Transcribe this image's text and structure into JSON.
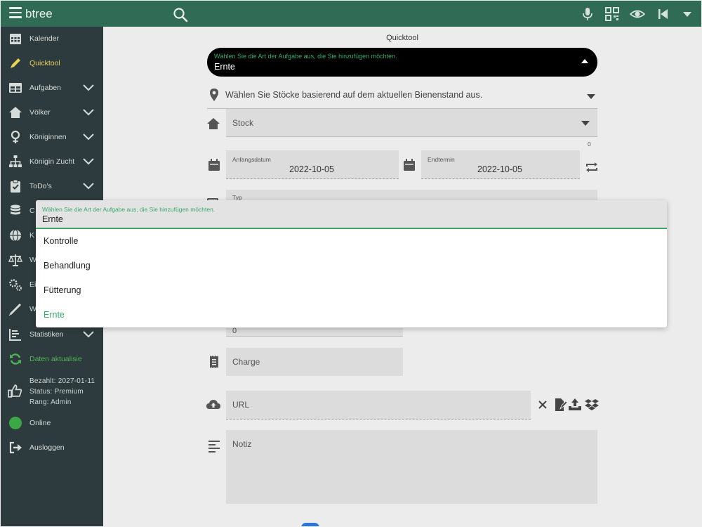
{
  "app": {
    "title": "btree"
  },
  "topbar": {
    "icons": [
      "menu-icon",
      "search-icon",
      "microphone-icon",
      "qr-code-icon",
      "eye-icon",
      "skip-back-icon",
      "caret-down-icon"
    ]
  },
  "sidebar": {
    "items": [
      {
        "label": "Kalender",
        "icon": "calendar-icon"
      },
      {
        "label": "Quicktool",
        "icon": "pencil-icon",
        "active": true
      },
      {
        "label": "Aufgaben",
        "icon": "table-icon",
        "expandable": true
      },
      {
        "label": "Völker",
        "icon": "home-icon",
        "expandable": true
      },
      {
        "label": "Königinnen",
        "icon": "female-icon",
        "expandable": true
      },
      {
        "label": "Königin Zucht",
        "icon": "sitemap-icon",
        "expandable": true
      },
      {
        "label": "ToDo's",
        "icon": "clipboard-check-icon",
        "expandable": true
      },
      {
        "label": "C",
        "icon": "database-icon"
      },
      {
        "label": "K",
        "icon": "globe-icon"
      },
      {
        "label": "W",
        "icon": "scale-icon"
      },
      {
        "label": "Ei",
        "icon": "cogs-icon"
      },
      {
        "label": "W",
        "icon": "syringe-icon"
      },
      {
        "label": "Statistiken",
        "icon": "chart-icon",
        "expandable": true
      },
      {
        "label": "Daten aktualisieren",
        "icon": "sync-icon"
      }
    ],
    "account": {
      "paid": "Bezahlt: 2027-01-11",
      "status": "Status: Premium",
      "rank": "Rang: Admin"
    },
    "online_label": "Online",
    "logout_label": "Ausloggen"
  },
  "main": {
    "title": "Quicktool",
    "task_type": {
      "label": "Wählen Sie die Art der Aufgabe aus, die Sie hinzufügen möchten.",
      "value": "Ernte"
    },
    "location_hint": "Wählen Sie Stöcke basierend auf dem aktuellen Bienenstand aus.",
    "hive_select": "Stock",
    "hive_count": "0",
    "start_date": {
      "label": "Anfangsdatum",
      "value": "2022-10-05"
    },
    "end_date": {
      "label": "Endtermin",
      "value": "2022-10-05"
    },
    "type_field": {
      "label": "Typ"
    },
    "amount_value": "0",
    "batch_placeholder": "Charge",
    "url_placeholder": "URL",
    "note_placeholder": "Notiz"
  },
  "dropdown": {
    "label": "Wählen Sie die Art der Aufgabe aus, die Sie hinzufügen möchten.",
    "value": "Ernte",
    "options": [
      "Kontrolle",
      "Behandlung",
      "Fütterung",
      "Ernte"
    ],
    "selected": "Ernte"
  },
  "colors": {
    "topbar": "#2f6b55",
    "sidebar": "#2e3b3e",
    "accent_green": "#3aa86b",
    "active_yellow": "#e6d05a"
  }
}
